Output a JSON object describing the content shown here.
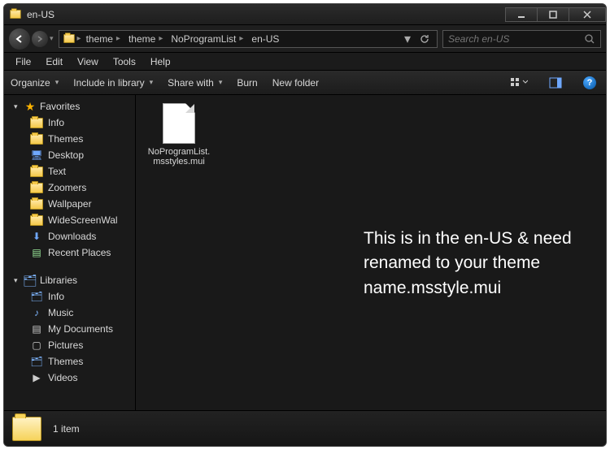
{
  "window": {
    "title": "en-US"
  },
  "breadcrumb": [
    "theme",
    "theme",
    "NoProgramList",
    "en-US"
  ],
  "search": {
    "placeholder": "Search en-US"
  },
  "menu": [
    "File",
    "Edit",
    "View",
    "Tools",
    "Help"
  ],
  "toolbar": {
    "organize": "Organize",
    "include": "Include in library",
    "share": "Share with",
    "burn": "Burn",
    "newfolder": "New folder"
  },
  "sidebar": {
    "favorites": {
      "label": "Favorites",
      "items": [
        "Info",
        "Themes",
        "Desktop",
        "Text",
        "Zoomers",
        "Wallpaper",
        "WideScreenWal",
        "Downloads",
        "Recent Places"
      ]
    },
    "libraries": {
      "label": "Libraries",
      "items": [
        "Info",
        "Music",
        "My Documents",
        "Pictures",
        "Themes",
        "Videos"
      ]
    }
  },
  "file": {
    "name": "NoProgramList.msstyles.mui"
  },
  "overlay": "This is in the en-US & need renamed to your theme name.msstyle.mui",
  "status": {
    "count": "1 item"
  }
}
